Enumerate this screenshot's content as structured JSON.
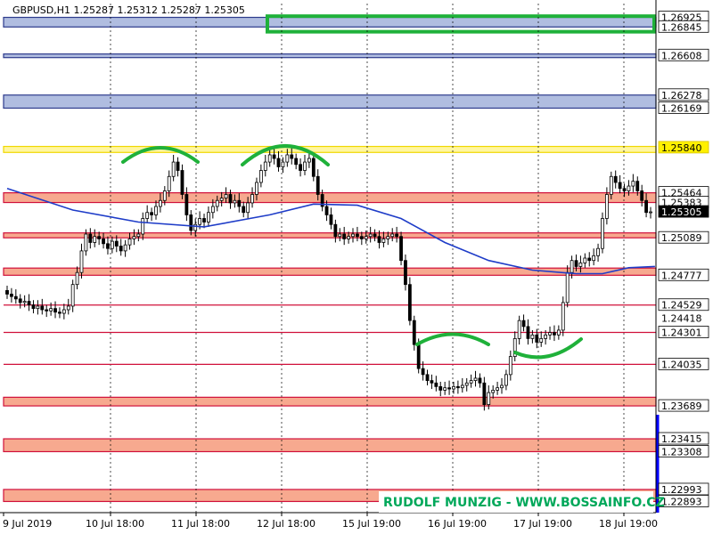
{
  "chart_data": {
    "type": "candlestick",
    "symbol_line": "GBPUSD,H1  1.25287 1.25312 1.25287 1.25305",
    "ylim": [
      1.228,
      1.2704
    ],
    "current_price": 1.25305,
    "x_labels": [
      "9 Jul 2019",
      "10 Jul 18:00",
      "11 Jul 18:00",
      "12 Jul 18:00",
      "15 Jul 19:00",
      "16 Jul 19:00",
      "17 Jul 19:00",
      "18 Jul 19:00"
    ],
    "price_labels": [
      {
        "text": "1.26925",
        "value": 1.26925,
        "style": "box"
      },
      {
        "text": "1.26845",
        "value": 1.26845,
        "style": "box"
      },
      {
        "text": "1.26608",
        "value": 1.26608,
        "style": "box"
      },
      {
        "text": "1.26278",
        "value": 1.26278,
        "style": "box"
      },
      {
        "text": "1.26169",
        "value": 1.26169,
        "style": "box"
      },
      {
        "text": "1.25840",
        "value": 1.2584,
        "style": "yellow"
      },
      {
        "text": "1.25464",
        "value": 1.25464,
        "style": "box"
      },
      {
        "text": "1.25383",
        "value": 1.25383,
        "style": "box"
      },
      {
        "text": "1.25305",
        "value": 1.25305,
        "style": "current"
      },
      {
        "text": "1.25089",
        "value": 1.25089,
        "style": "box"
      },
      {
        "text": "1.24777",
        "value": 1.24777,
        "style": "box"
      },
      {
        "text": "1.24529",
        "value": 1.24529,
        "style": "box"
      },
      {
        "text": "1.24418",
        "value": 1.24418,
        "style": "plain"
      },
      {
        "text": "1.24301",
        "value": 1.24301,
        "style": "box"
      },
      {
        "text": "1.24035",
        "value": 1.24035,
        "style": "box"
      },
      {
        "text": "1.23689",
        "value": 1.23689,
        "style": "box"
      },
      {
        "text": "1.23415",
        "value": 1.23415,
        "style": "box"
      },
      {
        "text": "1.23308",
        "value": 1.23308,
        "style": "box"
      },
      {
        "text": "1.22993",
        "value": 1.22993,
        "style": "box"
      },
      {
        "text": "1.22893",
        "value": 1.22893,
        "style": "box"
      }
    ],
    "zones": [
      {
        "top": 1.26925,
        "bottom": 1.26845,
        "kind": "resistance-blue"
      },
      {
        "top": 1.2662,
        "bottom": 1.2659,
        "kind": "resistance-blue"
      },
      {
        "top": 1.26278,
        "bottom": 1.26169,
        "kind": "resistance-blue"
      },
      {
        "top": 1.2585,
        "bottom": 1.258,
        "kind": "yellow"
      },
      {
        "top": 1.25464,
        "bottom": 1.25383,
        "kind": "red-zone"
      },
      {
        "top": 1.2513,
        "bottom": 1.25089,
        "kind": "red-zone"
      },
      {
        "top": 1.24837,
        "bottom": 1.24777,
        "kind": "red-zone"
      },
      {
        "top": 1.23761,
        "bottom": 1.23689,
        "kind": "red-zone"
      },
      {
        "top": 1.23415,
        "bottom": 1.23308,
        "kind": "red-zone"
      },
      {
        "top": 1.22993,
        "bottom": 1.22893,
        "kind": "red-zone"
      }
    ],
    "lines": [
      {
        "value": 1.24529,
        "kind": "red-line"
      },
      {
        "value": 1.24301,
        "kind": "red-line"
      },
      {
        "value": 1.24035,
        "kind": "red-line"
      }
    ],
    "candles_close": [
      1.2462,
      1.246,
      1.2458,
      1.2455,
      1.2456,
      1.2453,
      1.245,
      1.2452,
      1.2449,
      1.2448,
      1.245,
      1.2447,
      1.2446,
      1.2449,
      1.2452,
      1.247,
      1.248,
      1.2498,
      1.2512,
      1.2505,
      1.251,
      1.2508,
      1.2504,
      1.25,
      1.2506,
      1.2502,
      1.2498,
      1.2503,
      1.2508,
      1.251,
      1.2512,
      1.2525,
      1.253,
      1.2528,
      1.2535,
      1.254,
      1.2548,
      1.256,
      1.2572,
      1.2565,
      1.2545,
      1.2528,
      1.2515,
      1.252,
      1.2525,
      1.2522,
      1.253,
      1.2535,
      1.254,
      1.2542,
      1.2545,
      1.2538,
      1.254,
      1.2535,
      1.253,
      1.2538,
      1.2545,
      1.2555,
      1.2565,
      1.2572,
      1.2578,
      1.2575,
      1.2568,
      1.2572,
      1.2578,
      1.2575,
      1.257,
      1.2565,
      1.2572,
      1.2575,
      1.256,
      1.2545,
      1.2535,
      1.2528,
      1.252,
      1.251,
      1.2512,
      1.2508,
      1.251,
      1.2512,
      1.251,
      1.2508,
      1.251,
      1.2512,
      1.251,
      1.2505,
      1.2508,
      1.251,
      1.2512,
      1.251,
      1.249,
      1.247,
      1.244,
      1.242,
      1.24,
      1.2395,
      1.239,
      1.2388,
      1.2385,
      1.2382,
      1.2384,
      1.2383,
      1.2385,
      1.2384,
      1.2386,
      1.2388,
      1.239,
      1.2392,
      1.2388,
      1.237,
      1.238,
      1.2382,
      1.2384,
      1.2386,
      1.2395,
      1.241,
      1.2425,
      1.244,
      1.2435,
      1.2425,
      1.2428,
      1.2422,
      1.2425,
      1.2428,
      1.243,
      1.2428,
      1.2432,
      1.2455,
      1.248,
      1.249,
      1.2485,
      1.2488,
      1.2492,
      1.249,
      1.2494,
      1.25,
      1.2525,
      1.2545,
      1.256,
      1.2555,
      1.255,
      1.2548,
      1.2552,
      1.2556,
      1.2548,
      1.254,
      1.253,
      1.25305
    ],
    "ma_points": [
      [
        0,
        1.255
      ],
      [
        15,
        1.2532
      ],
      [
        30,
        1.2522
      ],
      [
        45,
        1.2518
      ],
      [
        60,
        1.2528
      ],
      [
        70,
        1.2537
      ],
      [
        80,
        1.2536
      ],
      [
        90,
        1.2525
      ],
      [
        100,
        1.2505
      ],
      [
        110,
        1.249
      ],
      [
        120,
        1.2482
      ],
      [
        130,
        1.2479
      ],
      [
        136,
        1.2479
      ],
      [
        142,
        1.2484
      ],
      [
        148,
        1.2485
      ]
    ],
    "watermark": "RUDOLF MUNZIG - WWW.BOSSAINFO.CZ"
  }
}
